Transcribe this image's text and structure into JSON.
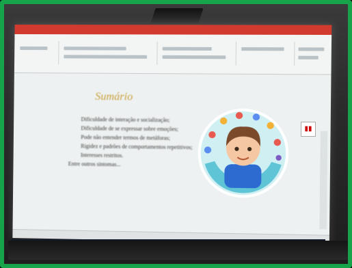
{
  "slide": {
    "title": "Sumário",
    "bullets": [
      "Dificuldade de interação e socialização;",
      "Dificuldade de se expressar sobre emoções;",
      "Pode não entender termos de metáforas;",
      "Rigidez e padrões de comportamentos repetitivos;",
      "Interesses restritos."
    ],
    "footer_bullet": "Entre outros sintomas..."
  },
  "colors": {
    "border": "#16a34a",
    "titlebar": "#d13a2e",
    "title_text": "#c9a23e"
  },
  "illustration": "boy-with-colorful-icons-circle"
}
